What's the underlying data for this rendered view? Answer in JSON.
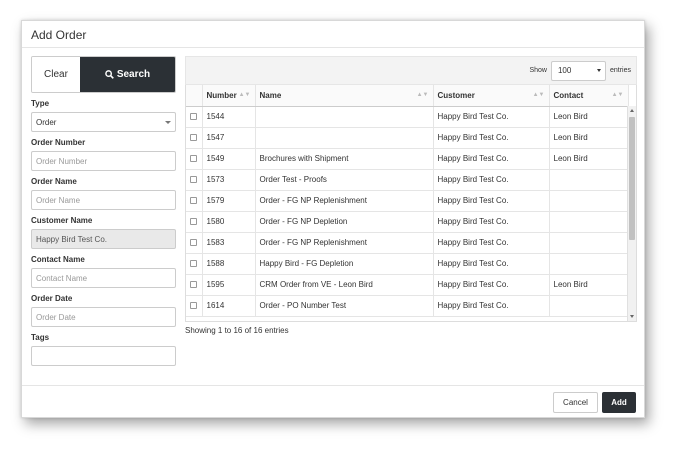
{
  "dialog": {
    "title": "Add Order"
  },
  "filters": {
    "clear_label": "Clear",
    "search_label": "Search",
    "type_label": "Type",
    "type_value": "Order",
    "order_number_label": "Order Number",
    "order_number_placeholder": "Order Number",
    "order_name_label": "Order Name",
    "order_name_placeholder": "Order Name",
    "customer_name_label": "Customer Name",
    "customer_name_value": "Happy Bird Test Co.",
    "contact_name_label": "Contact Name",
    "contact_name_placeholder": "Contact Name",
    "order_date_label": "Order Date",
    "order_date_placeholder": "Order Date",
    "tags_label": "Tags"
  },
  "table": {
    "show_label": "Show",
    "page_size": "100",
    "entries_label": "entries",
    "columns": [
      "Number",
      "Name",
      "Customer",
      "Contact"
    ],
    "rows": [
      {
        "number": "1544",
        "name": "",
        "customer": "Happy Bird Test Co.",
        "contact": "Leon Bird"
      },
      {
        "number": "1547",
        "name": "",
        "customer": "Happy Bird Test Co.",
        "contact": "Leon Bird"
      },
      {
        "number": "1549",
        "name": "Brochures with Shipment",
        "customer": "Happy Bird Test Co.",
        "contact": "Leon Bird"
      },
      {
        "number": "1573",
        "name": "Order Test - Proofs",
        "customer": "Happy Bird Test Co.",
        "contact": ""
      },
      {
        "number": "1579",
        "name": "Order - FG NP Replenishment",
        "customer": "Happy Bird Test Co.",
        "contact": ""
      },
      {
        "number": "1580",
        "name": "Order - FG NP Depletion",
        "customer": "Happy Bird Test Co.",
        "contact": ""
      },
      {
        "number": "1583",
        "name": "Order - FG NP Replenishment",
        "customer": "Happy Bird Test Co.",
        "contact": ""
      },
      {
        "number": "1588",
        "name": "Happy Bird - FG Depletion",
        "customer": "Happy Bird Test Co.",
        "contact": ""
      },
      {
        "number": "1595",
        "name": "CRM Order from VE - Leon Bird",
        "customer": "Happy Bird Test Co.",
        "contact": "Leon Bird"
      },
      {
        "number": "1614",
        "name": "Order - PO Number Test",
        "customer": "Happy Bird Test Co.",
        "contact": ""
      }
    ],
    "info": "Showing 1 to 16 of 16 entries"
  },
  "footer": {
    "cancel_label": "Cancel",
    "add_label": "Add"
  },
  "colors": {
    "dark_button": "#2b3035",
    "readonly_bg": "#e9e9e9"
  },
  "icons": {
    "search": "search-icon",
    "sort": "sort-icon"
  }
}
